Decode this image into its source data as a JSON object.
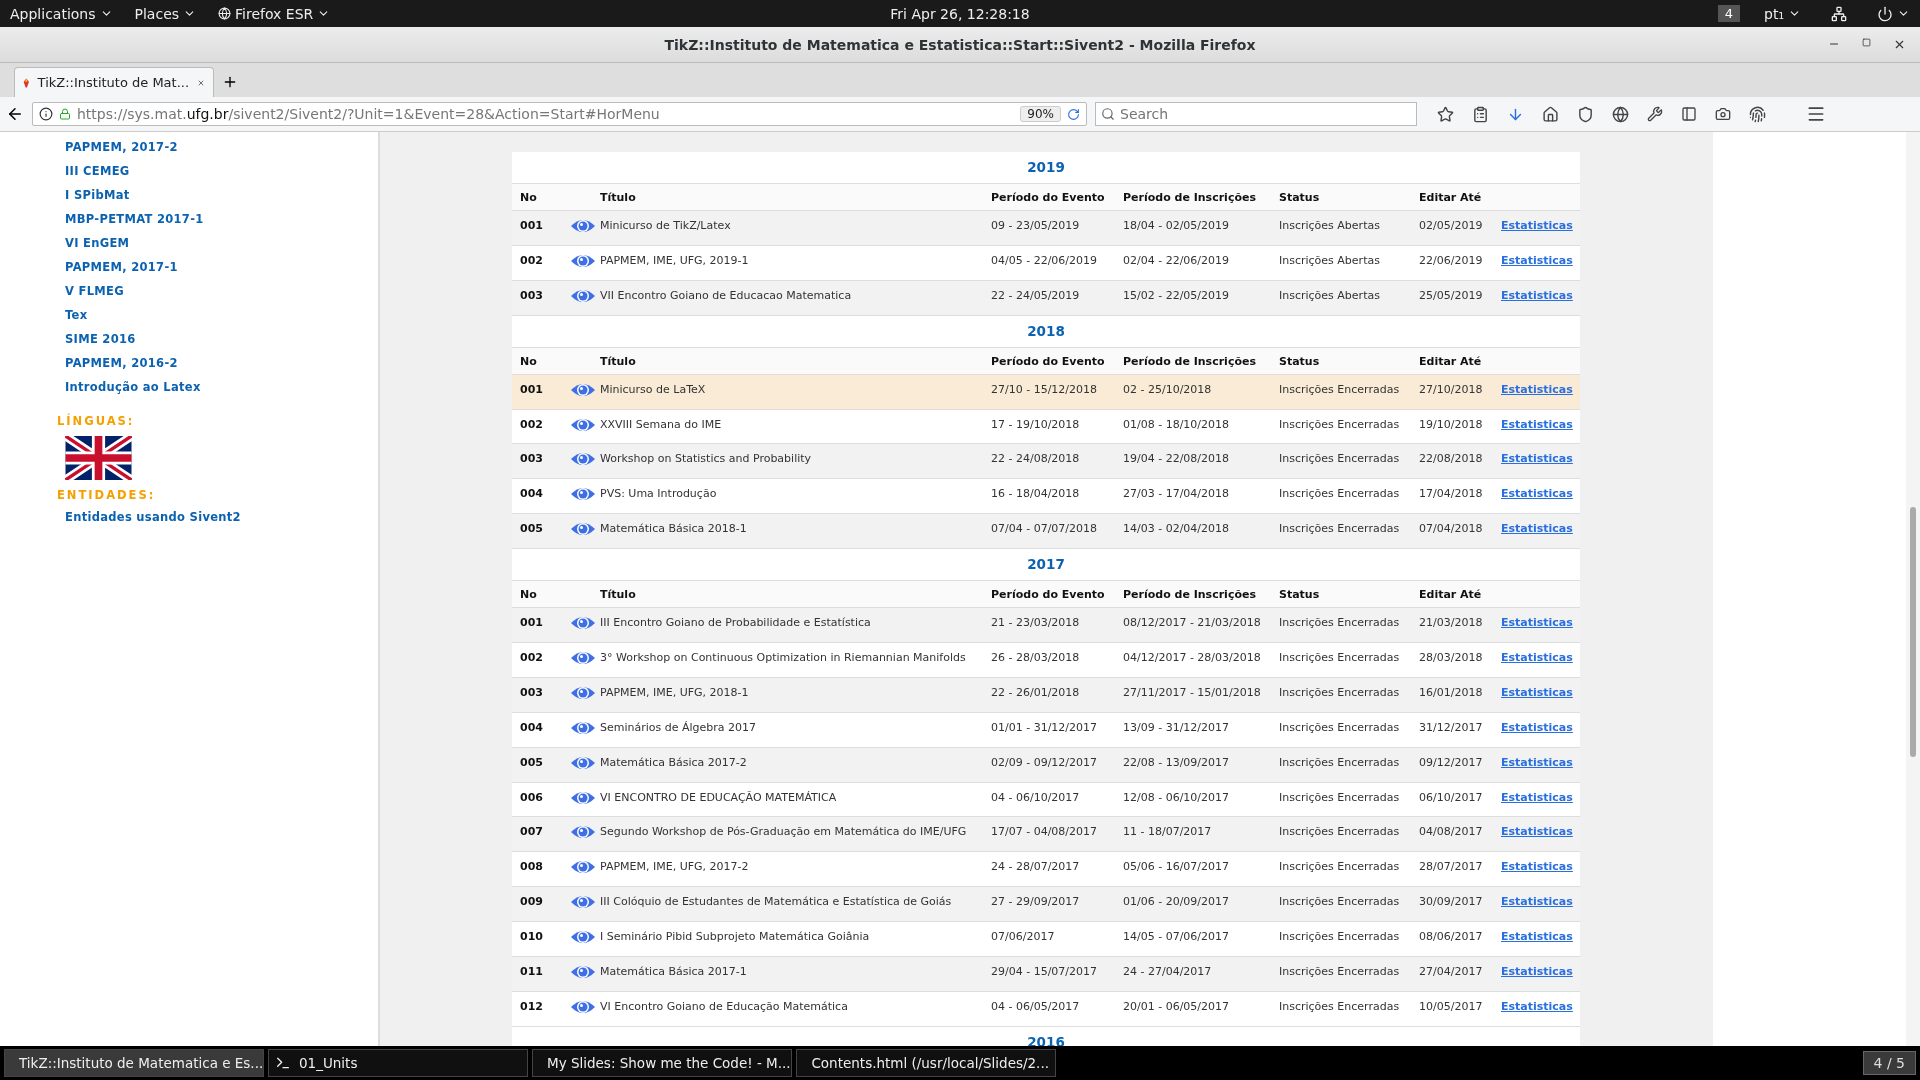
{
  "top_bar": {
    "menus": [
      {
        "label": "Applications"
      },
      {
        "label": "Places"
      },
      {
        "label": "Firefox ESR"
      }
    ],
    "clock": "Fri Apr 26, 12:28:18",
    "workspace": "4",
    "keyboard": "pt₁"
  },
  "window": {
    "title": "TikZ::Instituto de Matematica e Estatistica::Start::Sivent2 - Mozilla Firefox"
  },
  "tabs": [
    {
      "label": "TikZ::Instituto de Mat...",
      "selected": true
    }
  ],
  "nav": {
    "url": "https://sys.mat.**ufg.br**/sivent2/Sivent2/?Unit=1&Event=28&Action=Start#HorMenu",
    "zoom": "90%",
    "search": {
      "placeholder": "Search"
    }
  },
  "sidebar": {
    "items": [
      "PAPMEM, 2017-2",
      "III CEMEG",
      "I SPibMat",
      "MBP-PETMAT 2017-1",
      "VI EnGEM",
      "PAPMEM, 2017-1",
      "V FLMEG",
      "Tex",
      "SIME 2016",
      "PAPMEM, 2016-2",
      "Introdução ao Latex"
    ],
    "sections": [
      {
        "heading": "LÍNGUAS:",
        "kind": "flag"
      },
      {
        "heading": "ENTIDADES:",
        "kind": "link",
        "link": "Entidades usando Sivent2"
      }
    ]
  },
  "years": [
    {
      "year": "2019",
      "columns": [
        "No",
        "Título",
        "Período do Evento",
        "Período de Inscrições",
        "Status",
        "Editar Até"
      ],
      "rows": [
        {
          "no": "001",
          "title": "Minicurso de TikZ/Latex",
          "event": "09 - 23/05/2019",
          "inscr": "18/04 - 02/05/2019",
          "status": "Inscrições Abertas",
          "until": "02/05/2019",
          "link": "Estatisticas",
          "selected": false
        },
        {
          "no": "002",
          "title": "PAPMEM, IME, UFG, 2019-1",
          "event": "04/05 - 22/06/2019",
          "inscr": "02/04 - 22/06/2019",
          "status": "Inscrições Abertas",
          "until": "22/06/2019",
          "link": "Estatisticas",
          "selected": false
        },
        {
          "no": "003",
          "title": "VII Encontro Goiano de Educacao Matematica",
          "event": "22 - 24/05/2019",
          "inscr": "15/02 - 22/05/2019",
          "status": "Inscrições Abertas",
          "until": "25/05/2019",
          "link": "Estatisticas",
          "selected": false
        }
      ]
    },
    {
      "year": "2018",
      "columns": [
        "No",
        "Título",
        "Período do Evento",
        "Período de Inscrições",
        "Status",
        "Editar Até"
      ],
      "rows": [
        {
          "no": "001",
          "title": "Minicurso de LaTeX",
          "event": "27/10 - 15/12/2018",
          "inscr": "02 - 25/10/2018",
          "status": "Inscrições Encerradas",
          "until": "27/10/2018",
          "link": "Estatisticas",
          "selected": true
        },
        {
          "no": "002",
          "title": "XXVIII Semana do IME",
          "event": "17 - 19/10/2018",
          "inscr": "01/08 - 18/10/2018",
          "status": "Inscrições Encerradas",
          "until": "19/10/2018",
          "link": "Estatisticas",
          "selected": false
        },
        {
          "no": "003",
          "title": "Workshop on Statistics and Probability",
          "event": "22 - 24/08/2018",
          "inscr": "19/04 - 22/08/2018",
          "status": "Inscrições Encerradas",
          "until": "22/08/2018",
          "link": "Estatisticas",
          "selected": false
        },
        {
          "no": "004",
          "title": "PVS: Uma Introdução",
          "event": "16 - 18/04/2018",
          "inscr": "27/03 - 17/04/2018",
          "status": "Inscrições Encerradas",
          "until": "17/04/2018",
          "link": "Estatisticas",
          "selected": false
        },
        {
          "no": "005",
          "title": "Matemática Básica 2018-1",
          "event": "07/04 - 07/07/2018",
          "inscr": "14/03 - 02/04/2018",
          "status": "Inscrições Encerradas",
          "until": "07/04/2018",
          "link": "Estatisticas",
          "selected": false
        }
      ]
    },
    {
      "year": "2017",
      "columns": [
        "No",
        "Título",
        "Período do Evento",
        "Período de Inscrições",
        "Status",
        "Editar Até"
      ],
      "rows": [
        {
          "no": "001",
          "title": "III Encontro Goiano de Probabilidade e Estatística",
          "event": "21 - 23/03/2018",
          "inscr": "08/12/2017 - 21/03/2018",
          "status": "Inscrições Encerradas",
          "until": "21/03/2018",
          "link": "Estatisticas",
          "selected": false
        },
        {
          "no": "002",
          "title": "3° Workshop on Continuous Optimization in Riemannian Manifolds",
          "event": "26 - 28/03/2018",
          "inscr": "04/12/2017 - 28/03/2018",
          "status": "Inscrições Encerradas",
          "until": "28/03/2018",
          "link": "Estatisticas",
          "selected": false
        },
        {
          "no": "003",
          "title": "PAPMEM, IME, UFG, 2018-1",
          "event": "22 - 26/01/2018",
          "inscr": "27/11/2017 - 15/01/2018",
          "status": "Inscrições Encerradas",
          "until": "16/01/2018",
          "link": "Estatisticas",
          "selected": false
        },
        {
          "no": "004",
          "title": "Seminários de Álgebra 2017",
          "event": "01/01 - 31/12/2017",
          "inscr": "13/09 - 31/12/2017",
          "status": "Inscrições Encerradas",
          "until": "31/12/2017",
          "link": "Estatisticas",
          "selected": false
        },
        {
          "no": "005",
          "title": "Matemática Básica 2017-2",
          "event": "02/09 - 09/12/2017",
          "inscr": "22/08 - 13/09/2017",
          "status": "Inscrições Encerradas",
          "until": "09/12/2017",
          "link": "Estatisticas",
          "selected": false
        },
        {
          "no": "006",
          "title": "VI ENCONTRO DE EDUCAÇÃO MATEMÁTICA",
          "event": "04 - 06/10/2017",
          "inscr": "12/08 - 06/10/2017",
          "status": "Inscrições Encerradas",
          "until": "06/10/2017",
          "link": "Estatisticas",
          "selected": false
        },
        {
          "no": "007",
          "title": "Segundo Workshop de Pós-Graduação em Matemática do IME/UFG",
          "event": "17/07 - 04/08/2017",
          "inscr": "11 - 18/07/2017",
          "status": "Inscrições Encerradas",
          "until": "04/08/2017",
          "link": "Estatisticas",
          "selected": false
        },
        {
          "no": "008",
          "title": "PAPMEM, IME, UFG, 2017-2",
          "event": "24 - 28/07/2017",
          "inscr": "05/06 - 16/07/2017",
          "status": "Inscrições Encerradas",
          "until": "28/07/2017",
          "link": "Estatisticas",
          "selected": false
        },
        {
          "no": "009",
          "title": "III Colóquio de Estudantes de Matemática e Estatística de Goiás",
          "event": "27 - 29/09/2017",
          "inscr": "01/06 - 20/09/2017",
          "status": "Inscrições Encerradas",
          "until": "30/09/2017",
          "link": "Estatisticas",
          "selected": false
        },
        {
          "no": "010",
          "title": "I Seminário Pibid Subprojeto Matemática Goiânia",
          "event": "07/06/2017",
          "inscr": "14/05 - 07/06/2017",
          "status": "Inscrições Encerradas",
          "until": "08/06/2017",
          "link": "Estatisticas",
          "selected": false
        },
        {
          "no": "011",
          "title": "Matemática Básica 2017-1",
          "event": "29/04 - 15/07/2017",
          "inscr": "24 - 27/04/2017",
          "status": "Inscrições Encerradas",
          "until": "27/04/2017",
          "link": "Estatisticas",
          "selected": false
        },
        {
          "no": "012",
          "title": "VI Encontro Goiano de Educação Matemática",
          "event": "04 - 06/05/2017",
          "inscr": "20/01 - 06/05/2017",
          "status": "Inscrições Encerradas",
          "until": "10/05/2017",
          "link": "Estatisticas",
          "selected": false
        }
      ]
    },
    {
      "year": "2016"
    }
  ],
  "taskbar": {
    "tasks": [
      {
        "label": "TikZ::Instituto de Matematica e Es...",
        "kind": "firefox",
        "selected": true
      },
      {
        "label": "01_Units",
        "kind": "terminal",
        "selected": false
      },
      {
        "label": "My Slides: Show me the Code! - M...",
        "kind": "firefox",
        "selected": false
      },
      {
        "label": "Contents.html (/usr/local/Slides/2...",
        "kind": "editor",
        "selected": false
      }
    ],
    "workspace": "4 / 5"
  }
}
